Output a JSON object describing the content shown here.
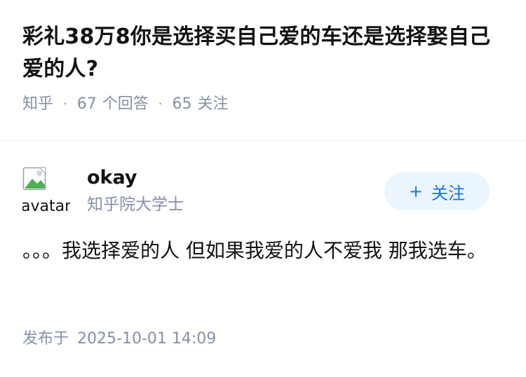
{
  "question": {
    "title": "彩礼38万8你是选择买自己爱的车还是选择娶自己爱的人?",
    "source": "知乎",
    "separator": "·",
    "answer_count": "67",
    "answer_count_label": "个回答",
    "follower_count": "65",
    "follower_count_label": "关注"
  },
  "author": {
    "name": "okay",
    "title": "知乎院大学士",
    "avatar_alt": "avatar",
    "avatar_icon": "broken-image-icon",
    "follow_plus": "+",
    "follow_label": "关注"
  },
  "answer": {
    "content": "。。。我选择爱的人 但如果我爱的人不爱我 那我选车。",
    "published_label": "发布于",
    "published_time": "2025-10-01 14:09"
  },
  "colors": {
    "text_primary": "#121212",
    "text_secondary": "#8590a6",
    "brand_blue": "#1772f6",
    "follow_bg": "#ebf5fd"
  }
}
